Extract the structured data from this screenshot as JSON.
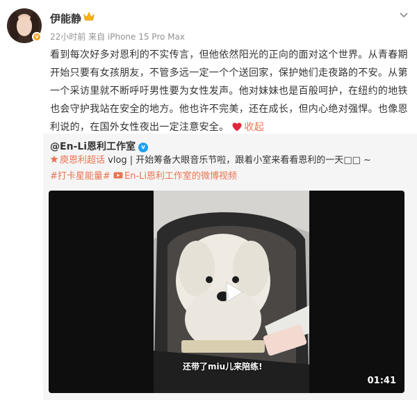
{
  "post": {
    "username": "伊能静",
    "meta": "22小时前  来自 iPhone 15 Pro Max",
    "content_lines": [
      "看到每次好多对恩利的不实传言，但他依然阳光的正向的面对这个世界。从青春期",
      "开始只要有女孩朋友，不管多远一定一个个送回家，保护她们走夜路的不安。从第",
      "一个采访里就不断呼吁男性要为女性发声。他对妹妹也是百般呵护，在纽约的地铁",
      "也会守护我站在安全的地方。他也许不完美，还在成长，但内心绝对强悍。也像恩",
      "利说的，在国外女性夜出一定注意安全。"
    ],
    "collapse_label": "收起"
  },
  "repost": {
    "username": "@En-Li恩利工作室",
    "super_topic": "庾恩利超话",
    "text": " vlog | 开始筹备大眼音乐节啦，跟着小室来看看恩利的一天",
    "text_tail": "□□ ~",
    "hashtag": "#打卡星能量#",
    "video_link": "En-Li恩利工作室的微博视频"
  },
  "video": {
    "duration": "01:41",
    "subtitle": "还带了miu儿来陪练!"
  },
  "colors": {
    "link": "#eb7350",
    "repost_bg": "#f5f5f5",
    "heart": "#e0263d"
  },
  "icons": [
    "crown-icon",
    "more-icon",
    "heart-icon",
    "verified-icon",
    "super-topic-icon",
    "video-link-icon",
    "play-icon"
  ]
}
